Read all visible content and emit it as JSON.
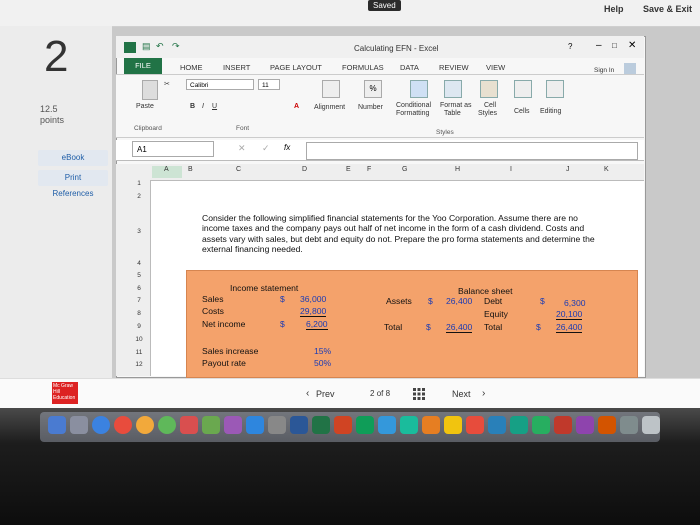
{
  "top": {
    "saved": "Saved",
    "help": "Help",
    "save_exit": "Save & Exit"
  },
  "left": {
    "question_number": "2",
    "points_value": "12.5",
    "points_label": "points",
    "nav": [
      "eBook",
      "Print",
      "References"
    ]
  },
  "excel": {
    "title": "Calculating EFN - Excel",
    "tabs": [
      "FILE",
      "HOME",
      "INSERT",
      "PAGE LAYOUT",
      "FORMULAS",
      "DATA",
      "REVIEW",
      "VIEW"
    ],
    "sign_in": "Sign In",
    "ribbon": {
      "font_name": "Calibri",
      "font_size": "11",
      "paste": "Paste",
      "bold": "B",
      "italic": "I",
      "underline": "U",
      "alignment": "Alignment",
      "number": "Number",
      "percent": "%",
      "conditional": "Conditional",
      "formatting": "Formatting",
      "format_as": "Format as",
      "table": "Table",
      "cell": "Cell",
      "styles_btn": "Styles",
      "cells": "Cells",
      "editing": "Editing",
      "groups": [
        "Clipboard",
        "Font",
        "Styles"
      ]
    },
    "name_box": "A1",
    "fx": "fx",
    "columns": [
      "A",
      "B",
      "C",
      "D",
      "E",
      "F",
      "G",
      "H",
      "I",
      "J",
      "K"
    ],
    "rows": [
      "1",
      "2",
      "3",
      "4",
      "5",
      "6",
      "7",
      "8",
      "9",
      "10",
      "11",
      "12"
    ],
    "prompt": "Consider the following simplified financial statements for the Yoo Corporation. Assume there are no income taxes and the company pays out half of net income in the form of a cash dividend. Costs and assets vary with sales, but debt and equity do not. Prepare the pro forma statements and determine the external financing needed.",
    "income_statement": {
      "title": "Income statement",
      "sales_label": "Sales",
      "sales_cur": "$",
      "sales_value": "36,000",
      "costs_label": "Costs",
      "costs_value": "29,800",
      "net_label": "Net income",
      "net_cur": "$",
      "net_value": "6,200"
    },
    "balance_sheet": {
      "title": "Balance sheet",
      "assets_label": "Assets",
      "assets_cur": "$",
      "assets_value": "26,400",
      "debt_label": "Debt",
      "debt_cur": "$",
      "debt_value": "6,300",
      "equity_label": "Equity",
      "equity_value": "20,100",
      "total_label": "Total",
      "total_cur": "$",
      "total_value": "26,400",
      "total2_label": "Total",
      "total2_cur": "$",
      "total2_value": "26,400"
    },
    "sales_increase_label": "Sales increase",
    "sales_increase_value": "15%",
    "payout_label": "Payout rate",
    "payout_value": "50%"
  },
  "bottom": {
    "brand": "Mc Graw Hill Education",
    "prev": "Prev",
    "page": "2",
    "of": "of",
    "total": "8",
    "next": "Next"
  },
  "colors": {
    "excel_green": "#217346",
    "highlight": "#f4a26b",
    "link_blue": "#1f5ea8"
  }
}
